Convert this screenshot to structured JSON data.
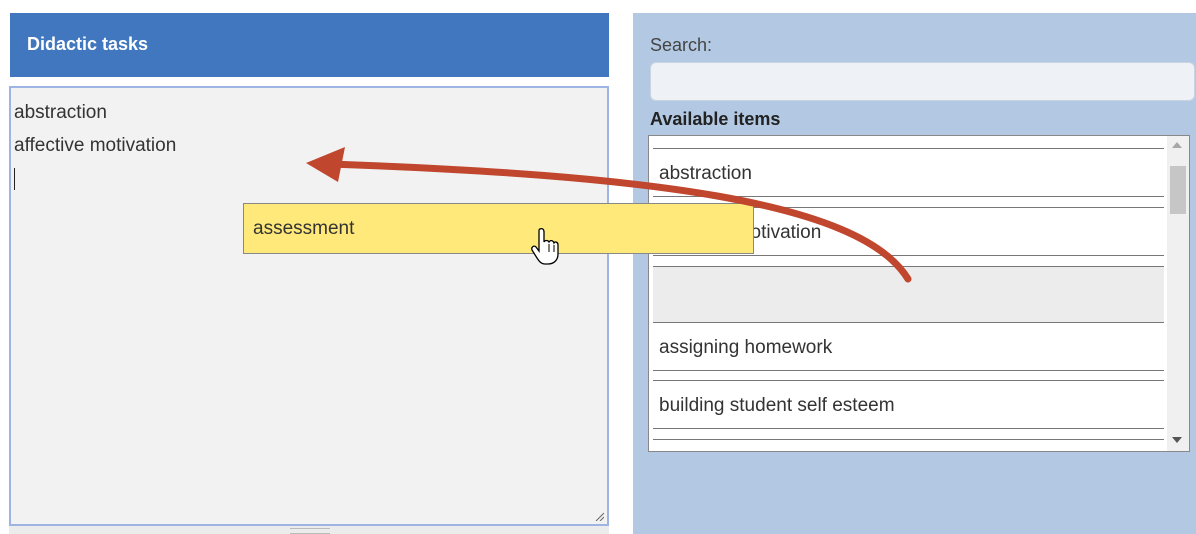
{
  "left_panel": {
    "title": "Didactic tasks",
    "lines": [
      "abstraction",
      "affective motivation"
    ]
  },
  "right_panel": {
    "search_label": "Search:",
    "search_value": "",
    "available_label": "Available items",
    "items": [
      "abstraction",
      "affective motivation",
      "",
      "assigning homework",
      "building student self esteem"
    ]
  },
  "drag": {
    "item_label": "assessment",
    "ghost_color": "#ffe97a",
    "arrow_color": "#c0472d",
    "cursor_icon": "hand-pointer-icon"
  },
  "colors": {
    "header_bg": "#4077be",
    "right_panel_bg": "#b3c9e3"
  }
}
